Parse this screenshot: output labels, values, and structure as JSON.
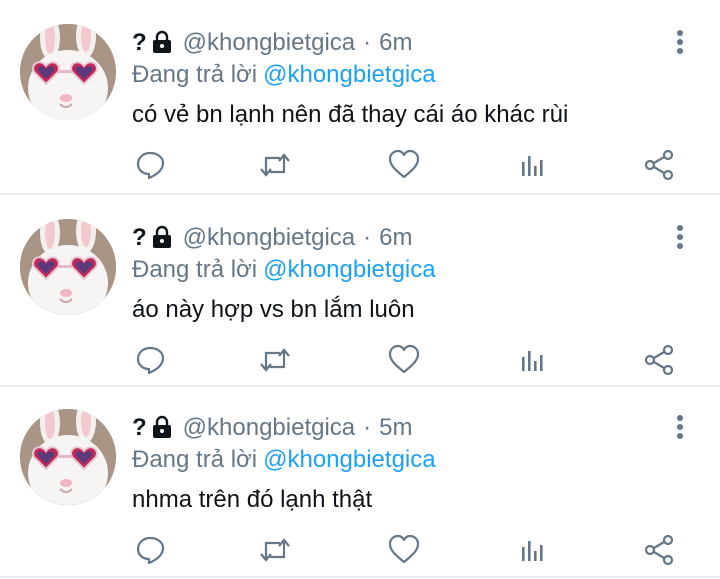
{
  "colors": {
    "text": "#0f1419",
    "muted": "#657786",
    "link": "#1da1f2",
    "divider": "#e6ecf0",
    "icon": "#657786"
  },
  "icons": [
    "lock-icon",
    "more-icon",
    "reply-icon",
    "retweet-icon",
    "like-icon",
    "stats-icon",
    "share-icon"
  ],
  "tweets": [
    {
      "name_prefix": "?",
      "handle": "@khongbietgica",
      "dot": "·",
      "time": "6m",
      "replying_label": "Đang trả lời",
      "replying_to": "@khongbietgica",
      "text": "có vẻ bn lạnh nên đã thay cái áo khác rùi"
    },
    {
      "name_prefix": "?",
      "handle": "@khongbietgica",
      "dot": "·",
      "time": "6m",
      "replying_label": "Đang trả lời",
      "replying_to": "@khongbietgica",
      "text": "áo này hợp vs bn lắm luôn"
    },
    {
      "name_prefix": "?",
      "handle": "@khongbietgica",
      "dot": "·",
      "time": "5m",
      "replying_label": "Đang trả lời",
      "replying_to": "@khongbietgica",
      "text": "nhma trên đó lạnh thật"
    }
  ]
}
